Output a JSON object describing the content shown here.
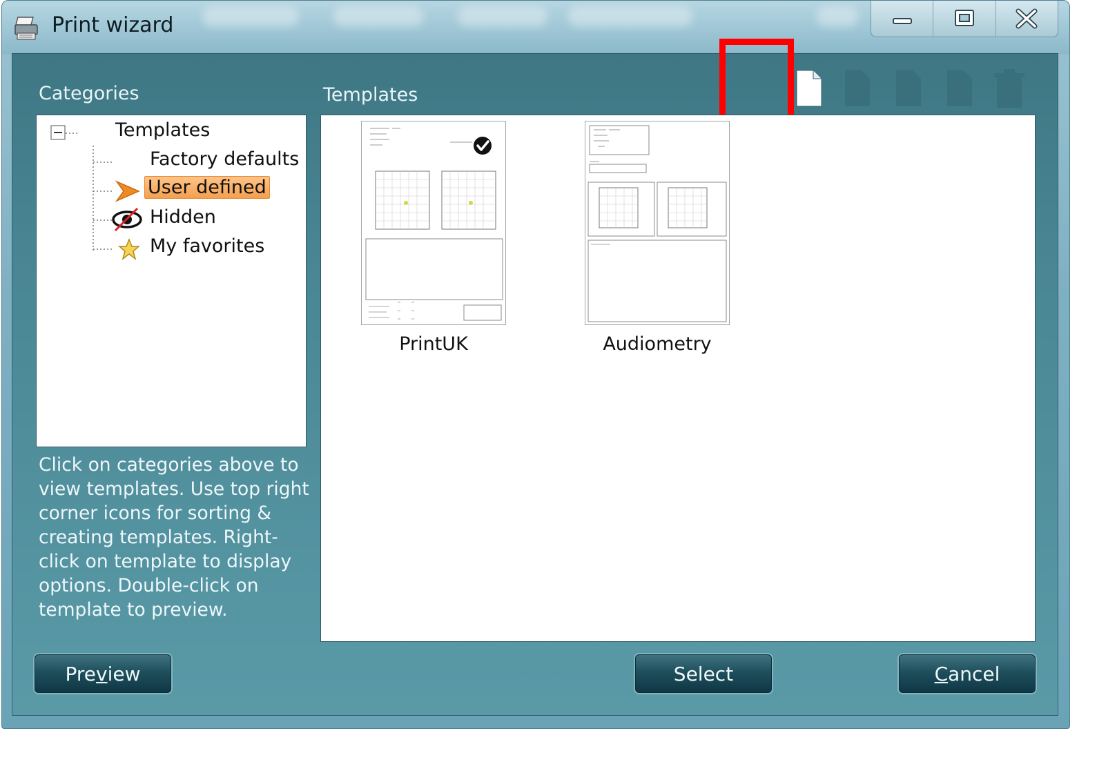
{
  "window": {
    "title": "Print wizard",
    "controls": [
      "minimize",
      "maximize",
      "close"
    ]
  },
  "categories": {
    "heading": "Categories",
    "tree": {
      "root": "Templates",
      "items": [
        {
          "label": "Factory defaults",
          "icon": "none",
          "selected": false
        },
        {
          "label": "User defined",
          "icon": "arrow-right-icon",
          "selected": true
        },
        {
          "label": "Hidden",
          "icon": "hidden-eye-icon",
          "selected": false
        },
        {
          "label": "My favorites",
          "icon": "star-icon",
          "selected": false
        }
      ]
    },
    "help": "Click on categories above to view templates. Use top right corner icons for sorting & creating templates. Right-click on template to display options. Double-click on template to preview."
  },
  "templates": {
    "heading": "Templates",
    "items": [
      {
        "name": "PrintUK",
        "default": true
      },
      {
        "name": "Audiometry",
        "default": false
      }
    ]
  },
  "buttons": {
    "preview": {
      "before": "Pre",
      "underline": "v",
      "after": "iew"
    },
    "select": "Select",
    "cancel": {
      "underline": "C",
      "after": "ancel"
    }
  },
  "colors": {
    "accent_selected": "#f3a04f",
    "highlight_box": "#ff0000",
    "client_bg": "#4a8795"
  }
}
